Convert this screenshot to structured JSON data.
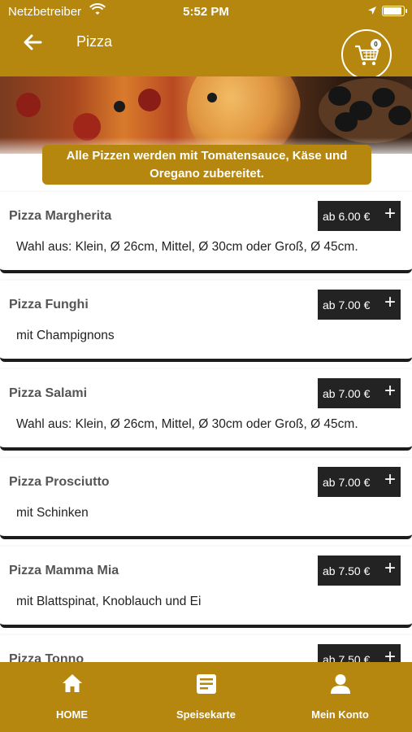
{
  "status_bar": {
    "carrier": "Netzbetreiber",
    "time": "5:52 PM"
  },
  "header": {
    "title": "Pizza",
    "cart_count": "0"
  },
  "notice": {
    "text": "Alle Pizzen werden mit Tomatensauce, Käse und Oregano zubereitet."
  },
  "menu_items": [
    {
      "name": "Pizza Margherita",
      "price": "ab 6.00 €",
      "description": "Wahl aus: Klein, Ø 26cm, Mittel, Ø 30cm oder Groß, Ø 45cm."
    },
    {
      "name": "Pizza Funghi",
      "price": "ab 7.00 €",
      "description": "mit Champignons"
    },
    {
      "name": "Pizza Salami",
      "price": "ab 7.00 €",
      "description": "Wahl aus: Klein, Ø 26cm, Mittel, Ø 30cm oder Groß, Ø 45cm."
    },
    {
      "name": "Pizza Prosciutto",
      "price": "ab 7.00 €",
      "description": "mit Schinken"
    },
    {
      "name": "Pizza Mamma Mia",
      "price": "ab 7.50 €",
      "description": "mit Blattspinat, Knoblauch und Ei"
    },
    {
      "name": "Pizza Tonno",
      "price": "ab 7.50 €",
      "description": ""
    }
  ],
  "tabs": [
    {
      "label": "HOME",
      "icon": "home-icon"
    },
    {
      "label": "Speisekarte",
      "icon": "menu-icon"
    },
    {
      "label": "Mein Konto",
      "icon": "account-icon"
    }
  ],
  "colors": {
    "accent": "#b5870f",
    "price_bg": "#232323"
  }
}
